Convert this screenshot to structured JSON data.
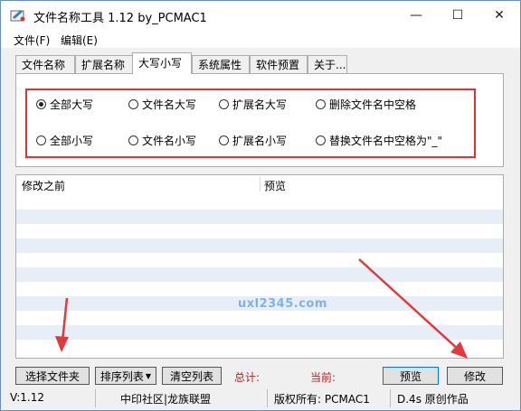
{
  "window": {
    "title": "文件名称工具 1.12   by_PCMAC1",
    "min_icon": "—",
    "max_icon": "☐",
    "close_icon": "✕"
  },
  "menu": {
    "file": "文件(F)",
    "edit": "编辑(E)"
  },
  "tabs": [
    {
      "label": "文件名称",
      "active": false
    },
    {
      "label": "扩展名称",
      "active": false
    },
    {
      "label": "大写小写",
      "active": true
    },
    {
      "label": "系统属性",
      "active": false
    },
    {
      "label": "软件预置",
      "active": false
    },
    {
      "label": "关于...",
      "active": false
    }
  ],
  "case_options": [
    {
      "label": "全部大写",
      "checked": true
    },
    {
      "label": "文件名大写",
      "checked": false
    },
    {
      "label": "扩展名大写",
      "checked": false
    },
    {
      "label": "删除文件名中空格",
      "checked": false
    },
    {
      "label": "全部小写",
      "checked": false
    },
    {
      "label": "文件名小写",
      "checked": false
    },
    {
      "label": "扩展名小写",
      "checked": false
    },
    {
      "label": "替换文件名中空格为\"_\"",
      "checked": false
    }
  ],
  "list": {
    "columns": [
      "修改之前",
      "预览"
    ]
  },
  "watermark": "uxl2345.com",
  "buttons": {
    "select_files": "选择文件夹",
    "sort_list": "排序列表",
    "clear_list": "清空列表",
    "preview": "预览",
    "modify": "修改"
  },
  "stats": {
    "total_label": "总计:",
    "current_label": "当前:"
  },
  "statusbar": {
    "version": "V:1.12",
    "community": "中印社区|龙族联盟",
    "copyright": "版权所有: PCMAC1",
    "author": "D.4s 原创作品"
  },
  "colors": {
    "highlight_box": "#e0313a",
    "arrow": "#e03a3e",
    "row_shade": "#e8eef8",
    "watermark": "#7fb2e6"
  }
}
